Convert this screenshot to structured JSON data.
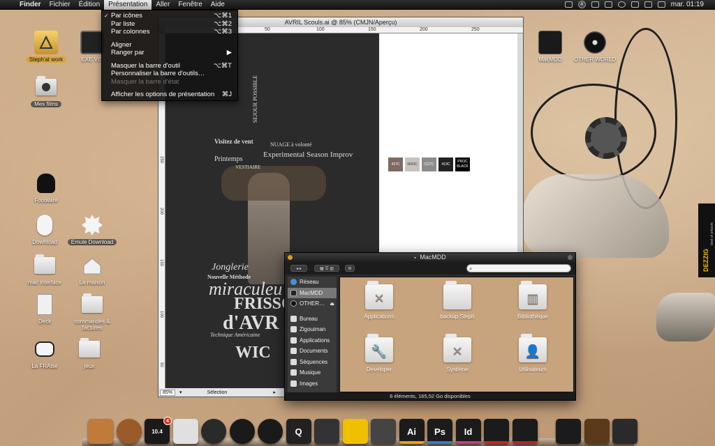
{
  "menubar": {
    "apple_icon": "apple-icon",
    "items": [
      "Finder",
      "Fichier",
      "Édition",
      "Présentation",
      "Aller",
      "Fenêtre",
      "Aide"
    ],
    "active_item": "Présentation",
    "badge": "4",
    "clock": "mar. 01:19"
  },
  "view_menu": {
    "items": [
      {
        "label": "Par icônes",
        "shortcut": "⌥⌘1",
        "checked": true
      },
      {
        "label": "Par liste",
        "shortcut": "⌥⌘2"
      },
      {
        "label": "Par colonnes",
        "shortcut": "⌥⌘3"
      },
      {
        "label": "Aligner",
        "shortcut": ""
      },
      {
        "label": "Ranger par",
        "shortcut": "▶"
      },
      {
        "label": "Masquer la barre d'outil",
        "shortcut": "⌥⌘T"
      },
      {
        "label": "Personnaliser la barre d'outils…",
        "shortcut": ""
      },
      {
        "label": "Masquer la barre d'état",
        "shortcut": "",
        "disabled": true
      },
      {
        "label": "Afficher les options de présentation",
        "shortcut": "⌘J"
      }
    ]
  },
  "desktop_icons": [
    {
      "label": "Steph'at work",
      "icon": "app-kit-icon"
    },
    {
      "label": "EXE VIS",
      "icon": "laptop-icon"
    },
    {
      "label": "Mes films",
      "icon": "movies-folder-icon"
    },
    {
      "label": "Footware",
      "icon": "cat-icon"
    },
    {
      "label": "Download",
      "icon": "download-icon"
    },
    {
      "label": "Emule Download",
      "icon": "emule-icon"
    },
    {
      "label": "mac interface",
      "icon": "folder-icon"
    },
    {
      "label": "La maison",
      "icon": "house-icon"
    },
    {
      "label": "Deck",
      "icon": "deck-icon"
    },
    {
      "label": "commandes & factures",
      "icon": "folder-icon"
    },
    {
      "label": "La FRAise",
      "icon": "dog-icon"
    },
    {
      "label": "jeux",
      "icon": "games-folder-icon"
    },
    {
      "label": "MacMDD",
      "icon": "hard-drive-icon"
    },
    {
      "label": "OTHER WORLD",
      "icon": "dvd-icon"
    }
  ],
  "doc_window": {
    "title": "AVRIL Scouls.ai @ 85% (CMJN/Aperçu)",
    "ruler_top": [
      "50",
      "100",
      "150",
      "200",
      "250"
    ],
    "ruler_left": [
      "250",
      "200",
      "150",
      "100",
      "50"
    ],
    "zoom": "85%",
    "status_label": "Sélection",
    "swatches": [
      {
        "label": "437C",
        "color": "#7d6a63"
      },
      {
        "label": "9603C",
        "color": "#c9c3bf"
      },
      {
        "label": "CG7C",
        "color": "#8c8c8c"
      },
      {
        "label": "419C",
        "color": "#222222"
      },
      {
        "label": "PROC BLACK",
        "color": "#050505"
      }
    ],
    "artwork_texts": [
      "Jonglerie",
      "Nouvelle Méthode",
      "miraculeu",
      "FRISSO",
      "d'AVR",
      "WIC",
      "Experimental Season Improv",
      "Visitez de vent",
      "Printemps",
      "VESTIAIRE",
      "SEJOUR POSSIBLE",
      "NUAGE à volonté",
      "Technique Américaine"
    ]
  },
  "finder": {
    "title": "MacMDD",
    "sidebar": [
      {
        "label": "Réseau",
        "icon": "network-icon"
      },
      {
        "label": "MacMDD",
        "icon": "hard-drive-icon",
        "selected": true
      },
      {
        "label": "OTHER…",
        "icon": "dvd-icon"
      },
      {
        "label": "Bureau",
        "icon": "desktop-icon"
      },
      {
        "label": "Zigouiman",
        "icon": "home-icon"
      },
      {
        "label": "Applications",
        "icon": "applications-icon"
      },
      {
        "label": "Documents",
        "icon": "documents-icon"
      },
      {
        "label": "Séquences",
        "icon": "movies-icon"
      },
      {
        "label": "Musique",
        "icon": "music-icon"
      },
      {
        "label": "Images",
        "icon": "pictures-icon"
      }
    ],
    "items": [
      {
        "label": "Applications",
        "glyph": "✕"
      },
      {
        "label": "backup Steph",
        "glyph": ""
      },
      {
        "label": "Bibliothèque",
        "glyph": "▥"
      },
      {
        "label": "Developer",
        "glyph": "🔧"
      },
      {
        "label": "Système",
        "glyph": "✕"
      },
      {
        "label": "Utilisateurs",
        "glyph": "👤"
      }
    ],
    "status": "6 éléments, 165,52 Go disponibles"
  },
  "dock": {
    "items": [
      {
        "name": "finder-icon",
        "label": "",
        "color": "#c07a3a"
      },
      {
        "name": "wood-disc-icon",
        "label": "",
        "color": "#9a5a2a"
      },
      {
        "name": "system-10-4-icon",
        "label": "10.4",
        "color": "#1a1a1a",
        "badge": "4"
      },
      {
        "name": "preview-icon",
        "label": "",
        "color": "#e0e0e0"
      },
      {
        "name": "safari-icon",
        "label": "",
        "color": "#2a2a2a"
      },
      {
        "name": "dvd-player-icon",
        "label": "",
        "color": "#1a1a1a"
      },
      {
        "name": "itunes-icon",
        "label": "",
        "color": "#1a1a1a"
      },
      {
        "name": "quicktime-icon",
        "label": "Q",
        "color": "#222"
      },
      {
        "name": "ink-pen-icon",
        "label": "",
        "color": "#333"
      },
      {
        "name": "pantone-icon",
        "label": "",
        "color": "#f0c000"
      },
      {
        "name": "utility-icon",
        "label": "",
        "color": "#444"
      },
      {
        "name": "illustrator-icon",
        "label": "Ai",
        "color": "#1b1b1b",
        "bar": "#f39c12"
      },
      {
        "name": "photoshop-icon",
        "label": "Ps",
        "color": "#1b1b1b",
        "bar": "#2f7fd0"
      },
      {
        "name": "indesign-icon",
        "label": "Id",
        "color": "#1b1b1b",
        "bar": "#c8378a"
      },
      {
        "name": "acrobat-icon",
        "label": "",
        "color": "#1b1b1b",
        "bar": "#d02020"
      },
      {
        "name": "flash-icon",
        "label": "",
        "color": "#1b1b1b",
        "bar": "#c02020"
      },
      {
        "name": "system-preferences-icon",
        "label": "",
        "color": "#1b1b1b"
      },
      {
        "name": "books-icon",
        "label": "",
        "color": "#5a3a1a"
      },
      {
        "name": "trash-icon",
        "label": "",
        "color": "#2a2a2a"
      }
    ]
  },
  "dezzig": {
    "text": "DEZZIG",
    "sub": "best of artwork"
  }
}
